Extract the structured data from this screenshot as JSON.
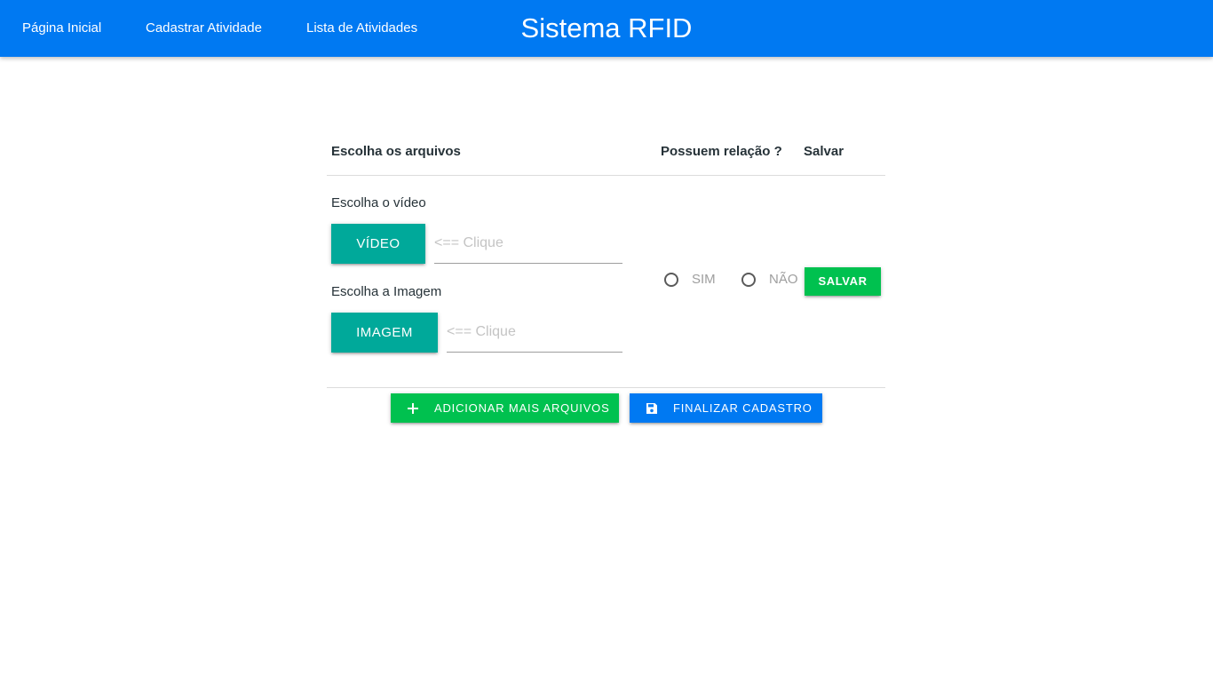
{
  "navbar": {
    "links": [
      {
        "label": "Página Inicial"
      },
      {
        "label": "Cadastrar Atividade"
      },
      {
        "label": "Lista de Atividades"
      }
    ],
    "brand": "Sistema RFID",
    "color": "#0079f2"
  },
  "table": {
    "headers": {
      "files": "Escolha os arquivos",
      "relation": "Possuem relação ?",
      "save": "Salvar"
    },
    "video": {
      "label": "Escolha o vídeo",
      "button": "VÍDEO",
      "placeholder": "<== Clique",
      "value": ""
    },
    "image": {
      "label": "Escolha a Imagem",
      "button": "IMAGEM",
      "placeholder": "<== Clique",
      "value": ""
    },
    "relation_options": [
      {
        "label": "SIM",
        "checked": false
      },
      {
        "label": "NÃO",
        "checked": false
      }
    ],
    "save_button": "SALVAR"
  },
  "actions": {
    "add_files": {
      "label": "ADICIONAR MAIS ARQUIVOS",
      "icon": "plus-icon",
      "color": "#00c14f"
    },
    "finish": {
      "label": "FINALIZAR CADASTRO",
      "icon": "floppy-disk-icon",
      "color": "#0079f2"
    }
  },
  "colors": {
    "teal": "#00a99a",
    "green": "#00c14f"
  }
}
